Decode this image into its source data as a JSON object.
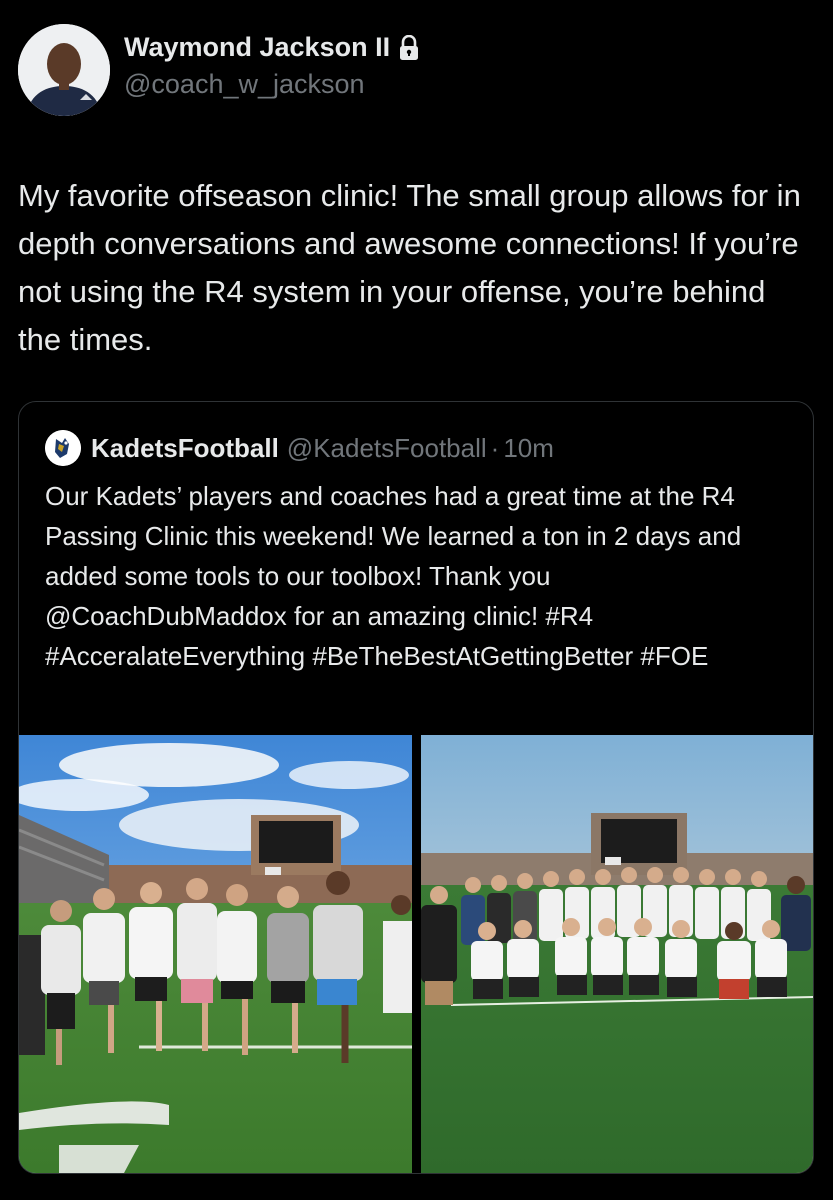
{
  "author": {
    "name": "Waymond Jackson II",
    "handle": "@coach_w_jackson"
  },
  "tweet": {
    "text": "My favorite offseason clinic! The small group allows for in depth conversations and awesome connections! If you’re not using the R4 system in your offense, you’re behind the times."
  },
  "quoted": {
    "name": "KadetsFootball",
    "handle": "@KadetsFootball",
    "separator": "·",
    "time": "10m",
    "text": "Our Kadets’ players and coaches had a great time at the R4 Passing Clinic this weekend! We learned a ton in 2 days and added some tools to our toolbox! Thank you @CoachDubMaddox for an amazing clinic! #R4 #AcceralateEverything #BeTheBestAtGettingBetter #FOE"
  },
  "icons": {
    "verified": "lock-icon",
    "quoted_avatar": "mascot-logo-icon"
  },
  "colors": {
    "background": "#000000",
    "text": "#e7e9ea",
    "muted": "#71767b",
    "border": "#2f3336"
  }
}
